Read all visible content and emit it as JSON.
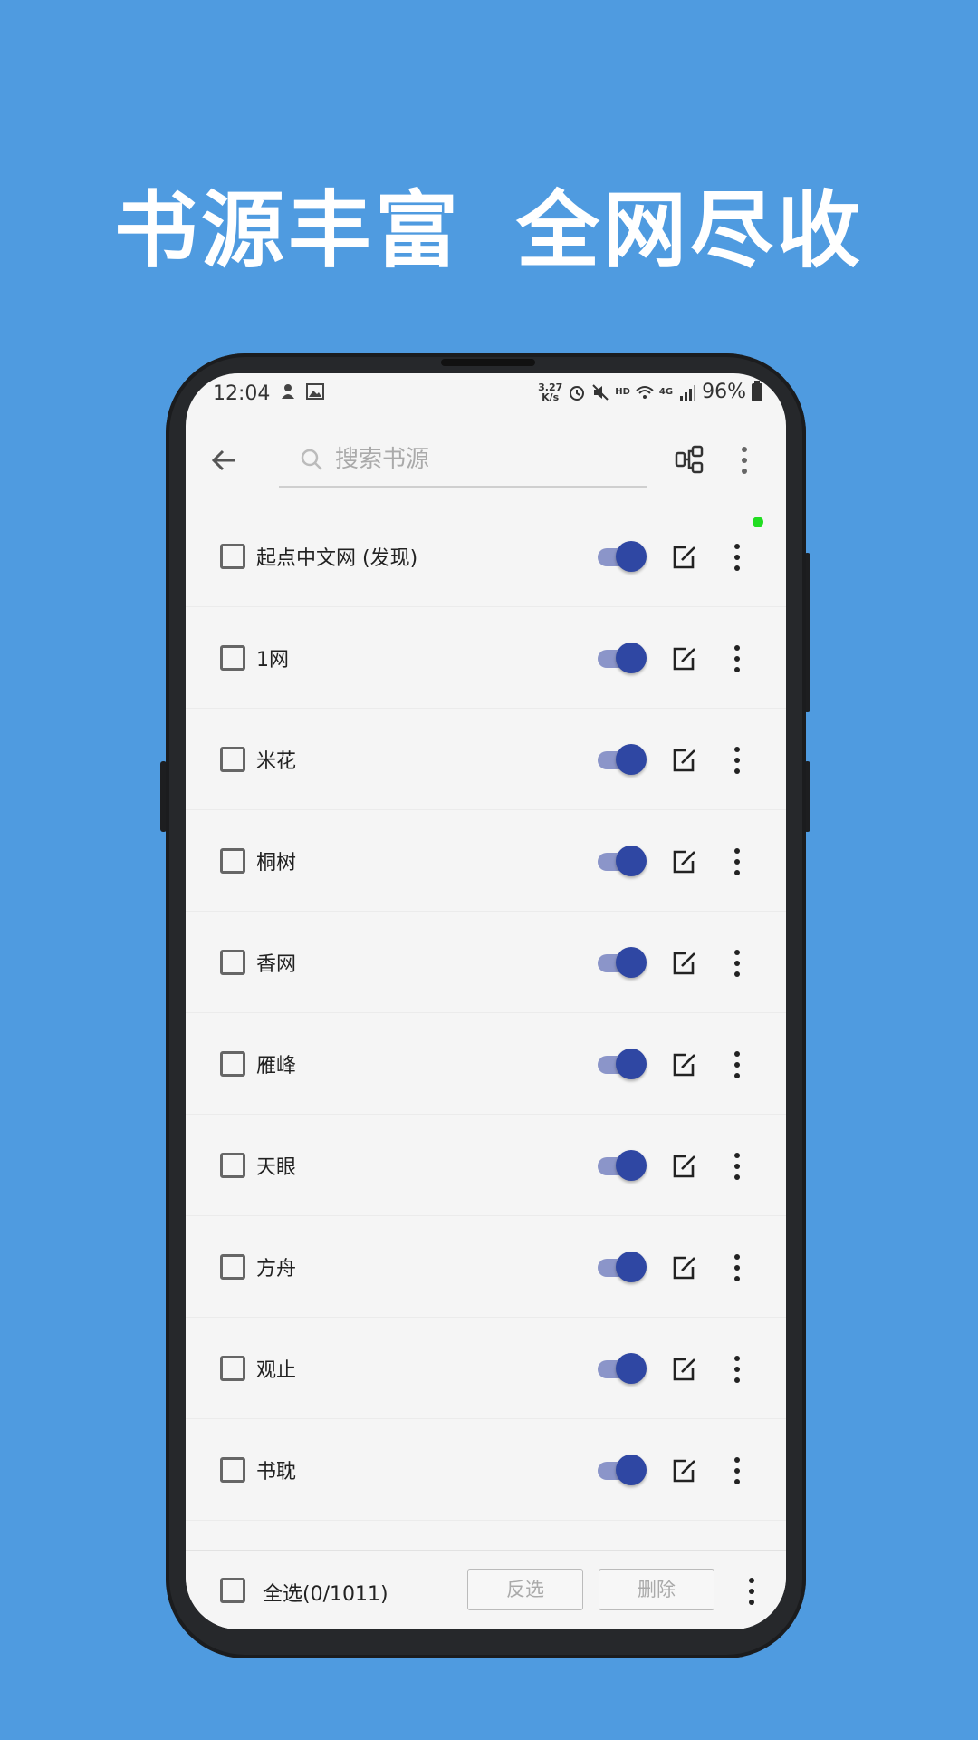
{
  "headline": {
    "part1": "书源丰富",
    "part2": "全网尽收"
  },
  "status_bar": {
    "time": "12:04",
    "speed_value": "3.27",
    "speed_unit": "K/s",
    "hd": "HD",
    "network": "4G",
    "battery": "96%"
  },
  "toolbar": {
    "search_placeholder": "搜索书源",
    "back_icon": "arrow-left-icon",
    "group_icon": "group-icon",
    "more_icon": "more-vert-icon"
  },
  "sources": [
    {
      "name": "起点中文网 (发现)",
      "enabled": true,
      "checked": false
    },
    {
      "name": "1网",
      "enabled": true,
      "checked": false
    },
    {
      "name": "米花",
      "enabled": true,
      "checked": false
    },
    {
      "name": "桐树",
      "enabled": true,
      "checked": false
    },
    {
      "name": "香网",
      "enabled": true,
      "checked": false
    },
    {
      "name": "雁峰",
      "enabled": true,
      "checked": false
    },
    {
      "name": "天眼",
      "enabled": true,
      "checked": false
    },
    {
      "name": "方舟",
      "enabled": true,
      "checked": false
    },
    {
      "name": "观止",
      "enabled": true,
      "checked": false
    },
    {
      "name": "书耽",
      "enabled": true,
      "checked": false
    }
  ],
  "bottom_bar": {
    "select_all_label": "全选(0/1011)",
    "invert_label": "反选",
    "delete_label": "删除"
  },
  "colors": {
    "background": "#4f9be0",
    "toggle_knob": "#2f47a3",
    "toggle_track": "#8b95c9",
    "indicator_dot": "#22dd22"
  }
}
